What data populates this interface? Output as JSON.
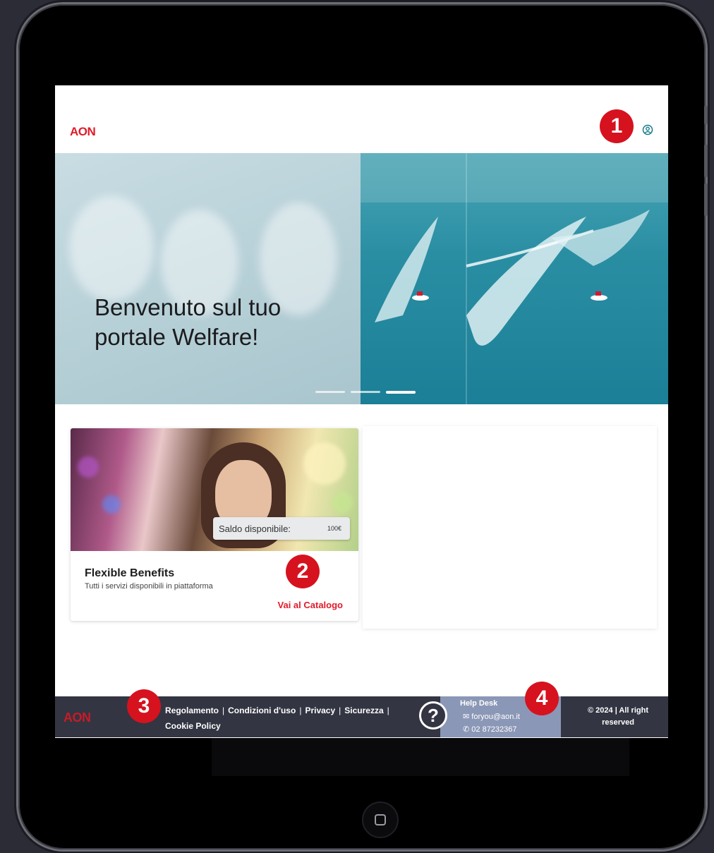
{
  "header": {
    "logo_text": "AON",
    "user_icon": "user-circle-icon"
  },
  "hero": {
    "title": "Benvenuto sul tuo portale Welfare!",
    "slides_count": 3,
    "active_slide": 3
  },
  "card": {
    "saldo_label": "Saldo disponibile:",
    "saldo_value": "100€",
    "title": "Flexible Benefits",
    "subtitle": "Tutti i servizi disponibili in piattaforma",
    "link_label": "Vai al Catalogo"
  },
  "footer": {
    "logo_text": "AON",
    "links": [
      "Regolamento",
      "Condizioni d'uso",
      "Privacy",
      "Sicurezza",
      "Cookie Policy"
    ],
    "helpdesk": {
      "title": "Help Desk",
      "email": "foryou@aon.it",
      "phone": "02 87232367",
      "icon": "question-circle-icon"
    },
    "copyright": "© 2024 | All right reserved"
  },
  "annotations": [
    "1",
    "2",
    "3",
    "4"
  ],
  "colors": {
    "brand_red": "#e01b2a",
    "footer_bg": "#333542",
    "helpdesk_bg": "#8b97b6",
    "badge_red": "#d6121f"
  }
}
